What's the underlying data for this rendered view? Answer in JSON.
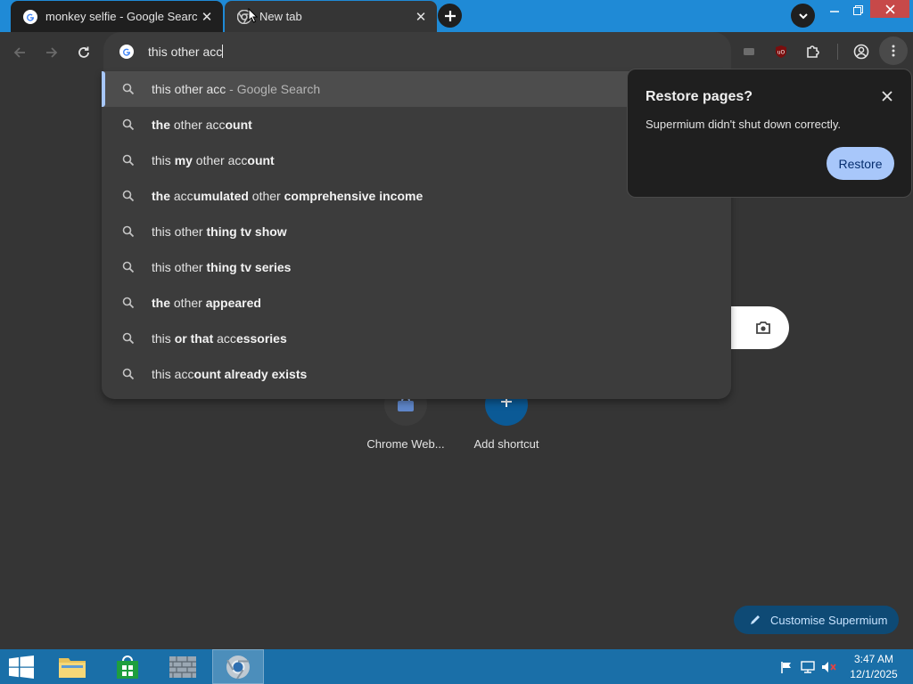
{
  "tabs": [
    {
      "title": "monkey selfie - Google Search",
      "active": false
    },
    {
      "title": "New tab",
      "active": true
    }
  ],
  "omnibox": {
    "text": "this other acc"
  },
  "suggestions": [
    {
      "parts": [
        {
          "t": "this other acc",
          "b": false
        },
        {
          "t": " - Google Search",
          "b": false,
          "desc": true
        }
      ]
    },
    {
      "parts": [
        {
          "t": "the",
          "b": true
        },
        {
          "t": " other acc",
          "b": false
        },
        {
          "t": "ount",
          "b": true
        }
      ]
    },
    {
      "parts": [
        {
          "t": "this ",
          "b": false
        },
        {
          "t": "my",
          "b": true
        },
        {
          "t": " other acc",
          "b": false
        },
        {
          "t": "ount",
          "b": true
        }
      ]
    },
    {
      "parts": [
        {
          "t": "the",
          "b": true
        },
        {
          "t": " acc",
          "b": false
        },
        {
          "t": "umulated",
          "b": true
        },
        {
          "t": " other ",
          "b": false
        },
        {
          "t": "comprehensive income",
          "b": true
        }
      ]
    },
    {
      "parts": [
        {
          "t": "this other ",
          "b": false
        },
        {
          "t": "thing tv show",
          "b": true
        }
      ]
    },
    {
      "parts": [
        {
          "t": "this other ",
          "b": false
        },
        {
          "t": "thing tv series",
          "b": true
        }
      ]
    },
    {
      "parts": [
        {
          "t": "the",
          "b": true
        },
        {
          "t": " other ",
          "b": false
        },
        {
          "t": "appeared",
          "b": true
        }
      ]
    },
    {
      "parts": [
        {
          "t": "this ",
          "b": false
        },
        {
          "t": "or that",
          "b": true
        },
        {
          "t": " acc",
          "b": false
        },
        {
          "t": "essories",
          "b": true
        }
      ]
    },
    {
      "parts": [
        {
          "t": "this acc",
          "b": false
        },
        {
          "t": "ount already exists",
          "b": true
        }
      ]
    }
  ],
  "restore_bubble": {
    "title": "Restore pages?",
    "message": "Supermium didn't shut down correctly.",
    "button": "Restore"
  },
  "shortcuts": [
    {
      "label": "Chrome Web..."
    },
    {
      "label": "Add shortcut"
    }
  ],
  "customise_label": "Customise Supermium",
  "taskbar": {
    "time": "3:47 AM",
    "date": "12/1/2025"
  },
  "colors": {
    "tabstrip": "#1f8ad6",
    "page_bg": "#353535",
    "accent": "#a8c7fa",
    "taskbar": "#1a6fa8"
  }
}
